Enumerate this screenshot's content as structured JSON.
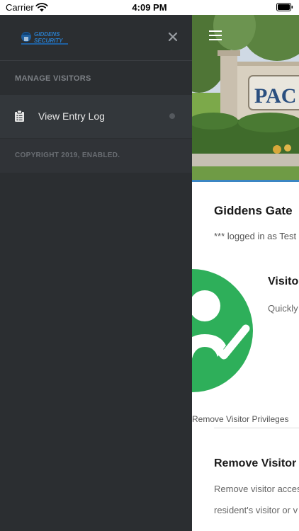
{
  "status_bar": {
    "carrier": "Carrier",
    "time": "4:09 PM",
    "wifi_icon": "wifi-icon",
    "battery_icon": "battery-icon"
  },
  "drawer": {
    "logo": {
      "text_top": "GIDDENS",
      "text_bottom": "SECURITY"
    },
    "close_icon": "close-icon",
    "section_label": "MANAGE VISITORS",
    "items": [
      {
        "label": "View Entry Log",
        "icon": "clipboard-list-icon"
      }
    ],
    "copyright": "COPYRIGHT 2019, ENABLED.",
    "colors": {
      "background": "#2b2e31",
      "item_background": "#33373b"
    }
  },
  "page": {
    "menu_icon": "hamburger-menu-icon",
    "hero_sign_text": "PAC",
    "title": "Giddens Gate",
    "logged_in": "*** logged in as Test",
    "card": {
      "title": "Visito",
      "text": "Quickly",
      "icon": "user-check-icon",
      "color": "#2eaf5a"
    },
    "remove_link": "Remove Visitor Privileges",
    "remove_section": {
      "title": "Remove Visitor",
      "line1": "Remove visitor acces",
      "line2": "resident's visitor or v"
    },
    "accent": "#3b86c3"
  }
}
